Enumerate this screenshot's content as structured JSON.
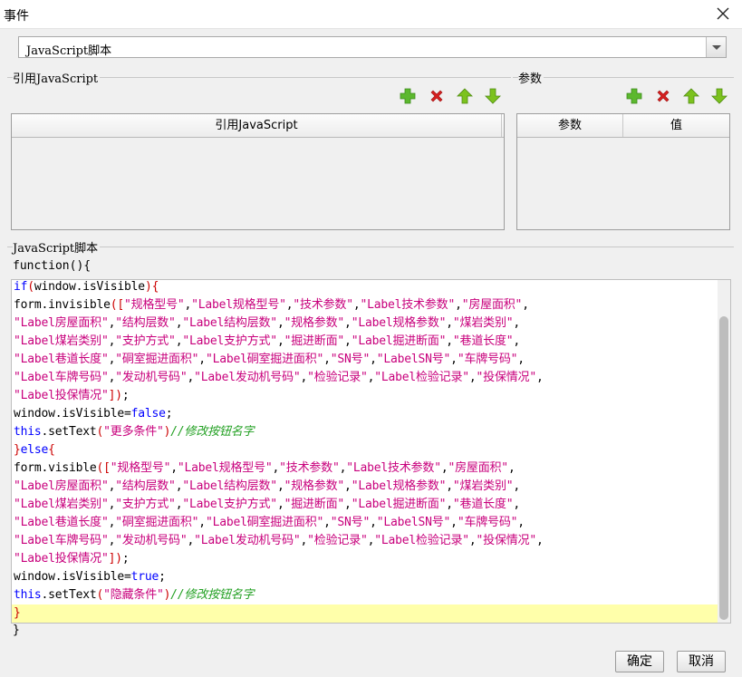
{
  "window": {
    "title": "事件"
  },
  "event_type": {
    "selected": "JavaScript脚本"
  },
  "ref_section": {
    "label": "引用JavaScript",
    "column": "引用JavaScript"
  },
  "param_section": {
    "label": "参数",
    "columns": [
      "参数",
      "值"
    ]
  },
  "script_section": {
    "label": "JavaScript脚本"
  },
  "code": {
    "header": "function(){",
    "footer": "}",
    "lines": [
      [
        [
          "kw",
          "if"
        ],
        [
          "pn",
          "("
        ],
        [
          "id",
          "window.isVisible"
        ],
        [
          "pn",
          ")"
        ],
        [
          "pn",
          "{"
        ]
      ],
      [
        [
          "id",
          "form.invisible"
        ],
        [
          "pn",
          "(["
        ],
        [
          "str",
          "\"规格型号\""
        ],
        [
          "id",
          ","
        ],
        [
          "str",
          "\"Label规格型号\""
        ],
        [
          "id",
          ","
        ],
        [
          "str",
          "\"技术参数\""
        ],
        [
          "id",
          ","
        ],
        [
          "str",
          "\"Label技术参数\""
        ],
        [
          "id",
          ","
        ],
        [
          "str",
          "\"房屋面积\""
        ],
        [
          "id",
          ","
        ]
      ],
      [
        [
          "str",
          "\"Label房屋面积\""
        ],
        [
          "id",
          ","
        ],
        [
          "str",
          "\"结构层数\""
        ],
        [
          "id",
          ","
        ],
        [
          "str",
          "\"Label结构层数\""
        ],
        [
          "id",
          ","
        ],
        [
          "str",
          "\"规格参数\""
        ],
        [
          "id",
          ","
        ],
        [
          "str",
          "\"Label规格参数\""
        ],
        [
          "id",
          ","
        ],
        [
          "str",
          "\"煤岩类别\""
        ],
        [
          "id",
          ","
        ]
      ],
      [
        [
          "str",
          "\"Label煤岩类别\""
        ],
        [
          "id",
          ","
        ],
        [
          "str",
          "\"支护方式\""
        ],
        [
          "id",
          ","
        ],
        [
          "str",
          "\"Label支护方式\""
        ],
        [
          "id",
          ","
        ],
        [
          "str",
          "\"掘进断面\""
        ],
        [
          "id",
          ","
        ],
        [
          "str",
          "\"Label掘进断面\""
        ],
        [
          "id",
          ","
        ],
        [
          "str",
          "\"巷道长度\""
        ],
        [
          "id",
          ","
        ]
      ],
      [
        [
          "str",
          "\"Label巷道长度\""
        ],
        [
          "id",
          ","
        ],
        [
          "str",
          "\"硐室掘进面积\""
        ],
        [
          "id",
          ","
        ],
        [
          "str",
          "\"Label硐室掘进面积\""
        ],
        [
          "id",
          ","
        ],
        [
          "str",
          "\"SN号\""
        ],
        [
          "id",
          ","
        ],
        [
          "str",
          "\"LabelSN号\""
        ],
        [
          "id",
          ","
        ],
        [
          "str",
          "\"车牌号码\""
        ],
        [
          "id",
          ","
        ]
      ],
      [
        [
          "str",
          "\"Label车牌号码\""
        ],
        [
          "id",
          ","
        ],
        [
          "str",
          "\"发动机号码\""
        ],
        [
          "id",
          ","
        ],
        [
          "str",
          "\"Label发动机号码\""
        ],
        [
          "id",
          ","
        ],
        [
          "str",
          "\"检验记录\""
        ],
        [
          "id",
          ","
        ],
        [
          "str",
          "\"Label检验记录\""
        ],
        [
          "id",
          ","
        ],
        [
          "str",
          "\"投保情况\""
        ],
        [
          "id",
          ","
        ]
      ],
      [
        [
          "str",
          "\"Label投保情况\""
        ],
        [
          "pn",
          "])"
        ],
        [
          "id",
          ";"
        ]
      ],
      [
        [
          "id",
          "window.isVisible="
        ],
        [
          "kw",
          "false"
        ],
        [
          "id",
          ";"
        ]
      ],
      [
        [
          "kw",
          "this"
        ],
        [
          "id",
          ".setText"
        ],
        [
          "pn",
          "("
        ],
        [
          "str",
          "\"更多条件\""
        ],
        [
          "pn",
          ")"
        ],
        [
          "cm",
          "//修改按钮名字"
        ]
      ],
      [
        [
          "pn",
          "}"
        ],
        [
          "kw",
          "else"
        ],
        [
          "pn",
          "{"
        ]
      ],
      [
        [
          "id",
          "form.visible"
        ],
        [
          "pn",
          "(["
        ],
        [
          "str",
          "\"规格型号\""
        ],
        [
          "id",
          ","
        ],
        [
          "str",
          "\"Label规格型号\""
        ],
        [
          "id",
          ","
        ],
        [
          "str",
          "\"技术参数\""
        ],
        [
          "id",
          ","
        ],
        [
          "str",
          "\"Label技术参数\""
        ],
        [
          "id",
          ","
        ],
        [
          "str",
          "\"房屋面积\""
        ],
        [
          "id",
          ","
        ]
      ],
      [
        [
          "str",
          "\"Label房屋面积\""
        ],
        [
          "id",
          ","
        ],
        [
          "str",
          "\"结构层数\""
        ],
        [
          "id",
          ","
        ],
        [
          "str",
          "\"Label结构层数\""
        ],
        [
          "id",
          ","
        ],
        [
          "str",
          "\"规格参数\""
        ],
        [
          "id",
          ","
        ],
        [
          "str",
          "\"Label规格参数\""
        ],
        [
          "id",
          ","
        ],
        [
          "str",
          "\"煤岩类别\""
        ],
        [
          "id",
          ","
        ]
      ],
      [
        [
          "str",
          "\"Label煤岩类别\""
        ],
        [
          "id",
          ","
        ],
        [
          "str",
          "\"支护方式\""
        ],
        [
          "id",
          ","
        ],
        [
          "str",
          "\"Label支护方式\""
        ],
        [
          "id",
          ","
        ],
        [
          "str",
          "\"掘进断面\""
        ],
        [
          "id",
          ","
        ],
        [
          "str",
          "\"Label掘进断面\""
        ],
        [
          "id",
          ","
        ],
        [
          "str",
          "\"巷道长度\""
        ],
        [
          "id",
          ","
        ]
      ],
      [
        [
          "str",
          "\"Label巷道长度\""
        ],
        [
          "id",
          ","
        ],
        [
          "str",
          "\"硐室掘进面积\""
        ],
        [
          "id",
          ","
        ],
        [
          "str",
          "\"Label硐室掘进面积\""
        ],
        [
          "id",
          ","
        ],
        [
          "str",
          "\"SN号\""
        ],
        [
          "id",
          ","
        ],
        [
          "str",
          "\"LabelSN号\""
        ],
        [
          "id",
          ","
        ],
        [
          "str",
          "\"车牌号码\""
        ],
        [
          "id",
          ","
        ]
      ],
      [
        [
          "str",
          "\"Label车牌号码\""
        ],
        [
          "id",
          ","
        ],
        [
          "str",
          "\"发动机号码\""
        ],
        [
          "id",
          ","
        ],
        [
          "str",
          "\"Label发动机号码\""
        ],
        [
          "id",
          ","
        ],
        [
          "str",
          "\"检验记录\""
        ],
        [
          "id",
          ","
        ],
        [
          "str",
          "\"Label检验记录\""
        ],
        [
          "id",
          ","
        ],
        [
          "str",
          "\"投保情况\""
        ],
        [
          "id",
          ","
        ]
      ],
      [
        [
          "str",
          "\"Label投保情况\""
        ],
        [
          "pn",
          "])"
        ],
        [
          "id",
          ";"
        ]
      ],
      [
        [
          "id",
          "window.isVisible="
        ],
        [
          "kw",
          "true"
        ],
        [
          "id",
          ";"
        ]
      ],
      [
        [
          "kw",
          "this"
        ],
        [
          "id",
          ".setText"
        ],
        [
          "pn",
          "("
        ],
        [
          "str",
          "\"隐藏条件\""
        ],
        [
          "pn",
          ")"
        ],
        [
          "cm",
          "//修改按钮名字"
        ]
      ],
      [
        [
          "pn",
          "}"
        ]
      ]
    ]
  },
  "buttons": {
    "ok": "确定",
    "cancel": "取消"
  },
  "icons": [
    "add-icon",
    "delete-icon",
    "move-up-icon",
    "move-down-icon",
    "close-icon",
    "dropdown-arrow-icon"
  ],
  "colors": {
    "add": "#5cb82e",
    "delete": "#d62020",
    "arrow": "#7cc21e",
    "highlight_line": "#ffffaa"
  }
}
